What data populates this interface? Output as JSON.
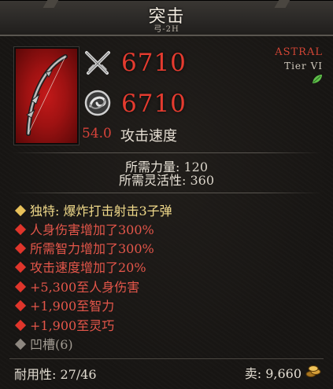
{
  "header": {
    "title": "突击",
    "subtitle": "弓-2H"
  },
  "rarity": {
    "label": "ASTRAL",
    "tier": "Tier VI",
    "icon": "leaf-icon",
    "color": "#d14535"
  },
  "stats": {
    "damage_value": "6710",
    "damage_icon": "crossed-swords-icon",
    "secondary_value": "6710",
    "secondary_icon": "swirl-icon",
    "attack_speed_value": "54.0",
    "attack_speed_label": "攻击速度"
  },
  "requirements": [
    {
      "label": "所需力量",
      "value": "120"
    },
    {
      "label": "所需灵活性",
      "value": "360"
    }
  ],
  "affixes": [
    {
      "type": "unique",
      "text": "独特: 爆炸打击射击3子弹"
    },
    {
      "type": "red",
      "text": "人身伤害增加了300%"
    },
    {
      "type": "red",
      "text": "所需智力增加了300%"
    },
    {
      "type": "red",
      "text": "攻击速度增加了20%"
    },
    {
      "type": "red",
      "text": "+5,300至人身伤害"
    },
    {
      "type": "red",
      "text": "+1,900至智力"
    },
    {
      "type": "red",
      "text": "+1,900至灵巧"
    },
    {
      "type": "gray",
      "text": "凹槽(6)"
    }
  ],
  "footer": {
    "durability_label": "耐用性",
    "durability_value": "27/46",
    "sell_label": "卖",
    "sell_value": "9,660",
    "gold_icon": "gold-coins-icon"
  },
  "colors": {
    "damage": "#e53b2f",
    "unique": "#f0d98a",
    "affix": "#e4564a",
    "socket": "#a29c93"
  }
}
